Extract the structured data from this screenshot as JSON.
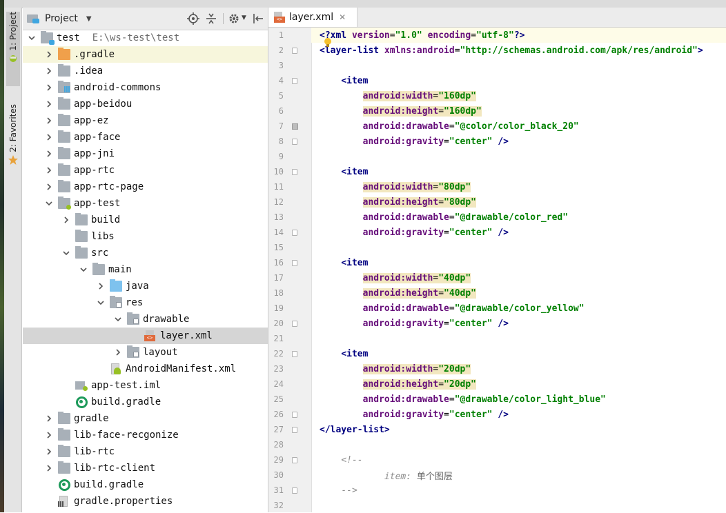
{
  "sidebar": {
    "tabs": [
      {
        "label": "1: Project"
      },
      {
        "label": "2: Favorites"
      }
    ]
  },
  "project_panel": {
    "title": "Project",
    "tree": [
      {
        "label": "test",
        "extra": "E:\\ws-test\\test",
        "depth": 0,
        "chevron": "down",
        "icon": "module"
      },
      {
        "label": ".gradle",
        "depth": 1,
        "chevron": "right",
        "icon": "folder-orange"
      },
      {
        "label": ".idea",
        "depth": 1,
        "chevron": "right",
        "icon": "folder"
      },
      {
        "label": "android-commons",
        "depth": 1,
        "chevron": "right",
        "icon": "module-lib"
      },
      {
        "label": "app-beidou",
        "depth": 1,
        "chevron": "right",
        "icon": "folder"
      },
      {
        "label": "app-ez",
        "depth": 1,
        "chevron": "right",
        "icon": "folder"
      },
      {
        "label": "app-face",
        "depth": 1,
        "chevron": "right",
        "icon": "folder"
      },
      {
        "label": "app-jni",
        "depth": 1,
        "chevron": "right",
        "icon": "folder"
      },
      {
        "label": "app-rtc",
        "depth": 1,
        "chevron": "right",
        "icon": "folder"
      },
      {
        "label": "app-rtc-page",
        "depth": 1,
        "chevron": "right",
        "icon": "folder"
      },
      {
        "label": "app-test",
        "depth": 1,
        "chevron": "down",
        "icon": "module-app"
      },
      {
        "label": "build",
        "depth": 2,
        "chevron": "right",
        "icon": "folder"
      },
      {
        "label": "libs",
        "depth": 2,
        "chevron": "none",
        "icon": "folder"
      },
      {
        "label": "src",
        "depth": 2,
        "chevron": "down",
        "icon": "folder"
      },
      {
        "label": "main",
        "depth": 3,
        "chevron": "down",
        "icon": "folder"
      },
      {
        "label": "java",
        "depth": 4,
        "chevron": "right",
        "icon": "folder-blue"
      },
      {
        "label": "res",
        "depth": 4,
        "chevron": "down",
        "icon": "folder-res"
      },
      {
        "label": "drawable",
        "depth": 5,
        "chevron": "down",
        "icon": "folder-res"
      },
      {
        "label": "layer.xml",
        "depth": 6,
        "chevron": "none",
        "icon": "xml-file"
      },
      {
        "label": "layout",
        "depth": 5,
        "chevron": "right",
        "icon": "folder-res"
      },
      {
        "label": "AndroidManifest.xml",
        "depth": 4,
        "chevron": "none",
        "icon": "manifest-file"
      },
      {
        "label": "app-test.iml",
        "depth": 2,
        "chevron": "none",
        "icon": "iml-file"
      },
      {
        "label": "build.gradle",
        "depth": 2,
        "chevron": "none",
        "icon": "gradle-file"
      },
      {
        "label": "gradle",
        "depth": 1,
        "chevron": "right",
        "icon": "folder"
      },
      {
        "label": "lib-face-recgonize",
        "depth": 1,
        "chevron": "right",
        "icon": "folder"
      },
      {
        "label": "lib-rtc",
        "depth": 1,
        "chevron": "right",
        "icon": "folder"
      },
      {
        "label": "lib-rtc-client",
        "depth": 1,
        "chevron": "right",
        "icon": "folder"
      },
      {
        "label": "build.gradle",
        "depth": 1,
        "chevron": "none",
        "icon": "gradle-file"
      },
      {
        "label": "gradle.properties",
        "depth": 1,
        "chevron": "none",
        "icon": "properties-file"
      }
    ]
  },
  "editor": {
    "tab": {
      "label": "layer.xml"
    },
    "lines": [
      {
        "n": "1",
        "kind": "decl",
        "text": ""
      },
      {
        "n": "2",
        "kind": "root",
        "text": ""
      },
      {
        "n": "3",
        "kind": "blank"
      },
      {
        "n": "4",
        "kind": "open",
        "tag": "item"
      },
      {
        "n": "5",
        "kind": "attr",
        "name": "width",
        "value": "160dp",
        "hl": true
      },
      {
        "n": "6",
        "kind": "attr",
        "name": "height",
        "value": "160dp",
        "hl": true
      },
      {
        "n": "7",
        "kind": "attr",
        "name": "drawable",
        "value": "@color/color_black_20",
        "hl": false
      },
      {
        "n": "8",
        "kind": "attrclose",
        "name": "gravity",
        "value": "center",
        "hl": false
      },
      {
        "n": "9",
        "kind": "blank"
      },
      {
        "n": "10",
        "kind": "open",
        "tag": "item"
      },
      {
        "n": "11",
        "kind": "attr",
        "name": "width",
        "value": "80dp",
        "hl": true
      },
      {
        "n": "12",
        "kind": "attr",
        "name": "height",
        "value": "80dp",
        "hl": true
      },
      {
        "n": "13",
        "kind": "attr",
        "name": "drawable",
        "value": "@drawable/color_red",
        "hl": false
      },
      {
        "n": "14",
        "kind": "attrclose",
        "name": "gravity",
        "value": "center",
        "hl": false
      },
      {
        "n": "15",
        "kind": "blank"
      },
      {
        "n": "16",
        "kind": "open",
        "tag": "item"
      },
      {
        "n": "17",
        "kind": "attr",
        "name": "width",
        "value": "40dp",
        "hl": true
      },
      {
        "n": "18",
        "kind": "attr",
        "name": "height",
        "value": "40dp",
        "hl": true
      },
      {
        "n": "19",
        "kind": "attr",
        "name": "drawable",
        "value": "@drawable/color_yellow",
        "hl": false
      },
      {
        "n": "20",
        "kind": "attrclose",
        "name": "gravity",
        "value": "center",
        "hl": false
      },
      {
        "n": "21",
        "kind": "blank"
      },
      {
        "n": "22",
        "kind": "open",
        "tag": "item"
      },
      {
        "n": "23",
        "kind": "attr",
        "name": "width",
        "value": "20dp",
        "hl": true
      },
      {
        "n": "24",
        "kind": "attr",
        "name": "height",
        "value": "20dp",
        "hl": true
      },
      {
        "n": "25",
        "kind": "attr",
        "name": "drawable",
        "value": "@drawable/color_light_blue",
        "hl": false
      },
      {
        "n": "26",
        "kind": "attrclose",
        "name": "gravity",
        "value": "center",
        "hl": false
      },
      {
        "n": "27",
        "kind": "closeroot"
      },
      {
        "n": "28",
        "kind": "blank"
      },
      {
        "n": "29",
        "kind": "commentopen",
        "text": "<!--"
      },
      {
        "n": "30",
        "kind": "commentbody",
        "key": "item",
        "text": "单个图层"
      },
      {
        "n": "31",
        "kind": "commentclose",
        "text": "-->"
      },
      {
        "n": "32",
        "kind": "blank"
      }
    ],
    "xml": {
      "version": "1.0",
      "encoding": "utf-8",
      "root_tag": "layer-list",
      "xmlns_android": "http://schemas.android.com/apk/res/android"
    }
  }
}
